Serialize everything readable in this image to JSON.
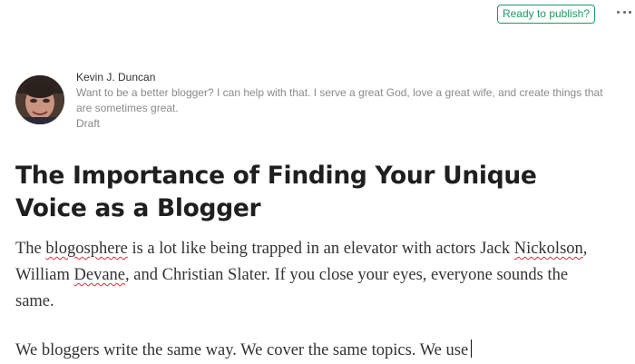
{
  "toolbar": {
    "publish_label": "Ready to publish?",
    "more_icon": "more-horizontal-icon",
    "accent_color": "#1c9963"
  },
  "author": {
    "name": "Kevin J. Duncan",
    "bio": "Want to be a better blogger? I can help with that. I serve a great God, love a great wife, and create things that are sometimes great.",
    "status": "Draft"
  },
  "post": {
    "title": "The Importance of Finding Your Unique Voice as a Blogger",
    "p1": {
      "s1": "The ",
      "w1": "blogosphere",
      "s2": " is a lot like being trapped in an elevator with actors Jack ",
      "w2": "Nickolson",
      "s3": ", William ",
      "w3": "Devane",
      "s4": ", and Christian Slater. If you close your eyes, everyone sounds the same."
    },
    "p2": "We bloggers write the same way. We cover the same topics. We use"
  }
}
